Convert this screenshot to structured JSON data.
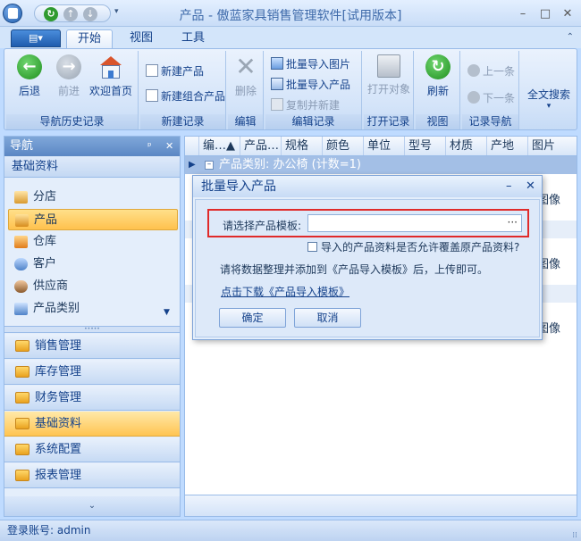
{
  "window": {
    "title": "产品 - 傲蓝家具销售管理软件[试用版本]",
    "minimize": "–",
    "maximize": "□",
    "close": "✕"
  },
  "ribbon_tabs": {
    "menu_glyph": "▤▾",
    "items": [
      "开始",
      "视图",
      "工具"
    ],
    "collapse_glyph": "⌃"
  },
  "ribbon": {
    "nav_history": {
      "back": "后退",
      "forward": "前进",
      "home": "欢迎首页",
      "label": "导航历史记录"
    },
    "new_record": {
      "new_product": "新建产品",
      "new_combo": "新建组合产品",
      "label": "新建记录"
    },
    "edit": {
      "delete": "删除",
      "label": "编辑"
    },
    "edit_record": {
      "import_images": "批量导入图片",
      "import_products": "批量导入产品",
      "copy_new": "复制并新建",
      "label": "编辑记录"
    },
    "open_record": {
      "open_object": "打开对象",
      "label": "打开记录"
    },
    "view": {
      "refresh": "刷新",
      "label": "视图"
    },
    "record_nav": {
      "prev": "上一条",
      "next": "下一条",
      "label": "记录导航"
    },
    "search": {
      "full_text": "全文搜索"
    }
  },
  "nav": {
    "header": "导航",
    "pin": "ᵖ",
    "close": "✕",
    "section_title": "基础资料",
    "items": [
      "分店",
      "产品",
      "仓库",
      "客户",
      "供应商",
      "产品类别"
    ],
    "groups": [
      "销售管理",
      "库存管理",
      "财务管理",
      "基础资料",
      "系统配置",
      "报表管理"
    ],
    "footer_glyph": "⌄"
  },
  "grid": {
    "columns": [
      "编…▲",
      "产品…",
      "规格",
      "颜色",
      "单位",
      "型号",
      "材质",
      "产地",
      "图片"
    ],
    "group_row": "产品类别: 办公椅 (计数=1)",
    "image_cells": [
      "图像",
      "图像",
      "图像"
    ]
  },
  "dialog": {
    "title": "批量导入产品",
    "min": "–",
    "close": "✕",
    "field_label": "请选择产品模板:",
    "field_value": "",
    "ellipsis": "···",
    "checkbox_label": "导入的产品资料是否允许覆盖原产品资料?",
    "info": "请将数据整理并添加到《产品导入模板》后，上传即可。",
    "download_link": "点击下载《产品导入模板》",
    "ok": "确定",
    "cancel": "取消"
  },
  "status": {
    "account": "登录账号: admin"
  },
  "colors": {
    "accent": "#15428b",
    "active_item": "#ffc14d",
    "highlight_border": "#e02a2a"
  }
}
